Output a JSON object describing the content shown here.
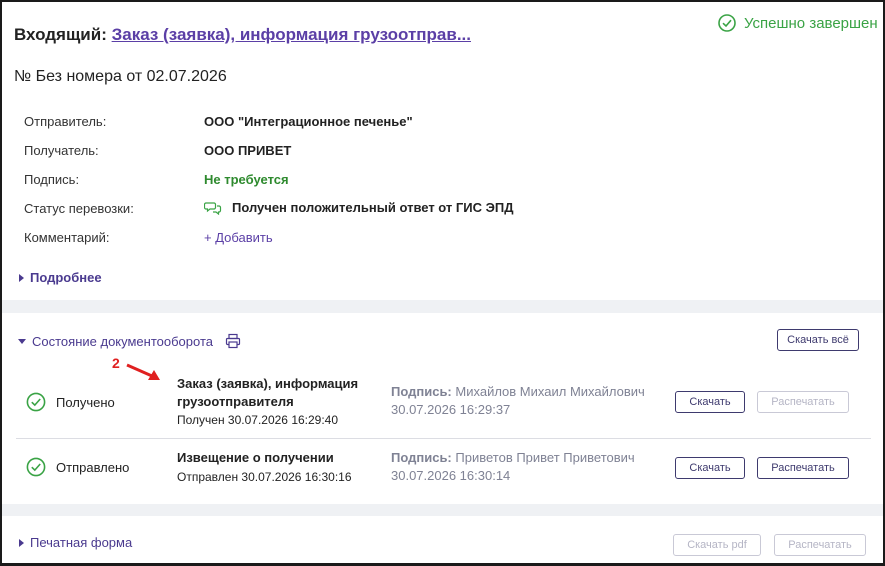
{
  "header": {
    "prefix": "Входящий:",
    "doc_link": "Заказ (заявка), информация грузоотправ...",
    "status": "Успешно завершен",
    "doc_number": "№ Без номера от 02.07.2026"
  },
  "fields": [
    {
      "label": "Отправитель:",
      "value": "ООО \"Интеграционное печенье\""
    },
    {
      "label": "Получатель:",
      "value": "ООО ПРИВЕТ"
    },
    {
      "label": "Подпись:",
      "value": "Не требуется"
    },
    {
      "label": "Статус перевозки:",
      "value": "Получен положительный ответ от ГИС ЭПД"
    },
    {
      "label": "Комментарий:",
      "value": "+ Добавить"
    }
  ],
  "more_toggle": "Подробнее",
  "workflow": {
    "title": "Состояние документооборота",
    "download_all": "Скачать всё",
    "rows": [
      {
        "state": "Получено",
        "doc_name": "Заказ (заявка), информация грузоотправителя",
        "doc_date": "Получен 30.07.2026 16:29:40",
        "sig_label": "Подпись:",
        "sig_value": "Михайлов Михаил Михайлович 30.07.2026 16:29:37",
        "download": "Скачать",
        "print": "Распечатать",
        "print_enabled": false
      },
      {
        "state": "Отправлено",
        "doc_name": "Извещение о получении",
        "doc_date": "Отправлен 30.07.2026 16:30:16",
        "sig_label": "Подпись:",
        "sig_value": "Приветов Привет Приветович 30.07.2026 16:30:14",
        "download": "Скачать",
        "print": "Распечатать",
        "print_enabled": true
      }
    ]
  },
  "annotation": {
    "number": "2",
    "color": "#e02020"
  },
  "print_form": {
    "title": "Печатная форма",
    "download_pdf": "Скачать pdf",
    "print": "Распечатать"
  },
  "colors": {
    "accent": "#5b3fa6",
    "success": "#3aa345"
  }
}
